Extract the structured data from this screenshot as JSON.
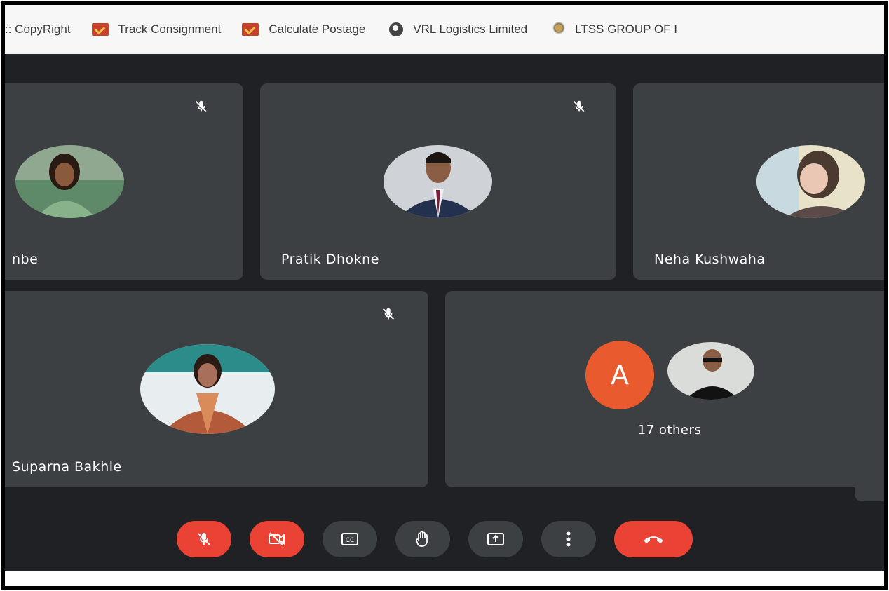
{
  "bookmarks": [
    {
      "label": ":: CopyRight",
      "icon": "none"
    },
    {
      "label": "Track Consignment",
      "icon": "checkmark-icon"
    },
    {
      "label": "Calculate Postage",
      "icon": "checkmark-icon"
    },
    {
      "label": "VRL Logistics Limited",
      "icon": "globe-icon"
    },
    {
      "label": "LTSS GROUP OF I",
      "icon": "emblem-icon"
    }
  ],
  "tiles": [
    {
      "name": "nbe",
      "muted": true
    },
    {
      "name": "Pratik Dhokne",
      "muted": true
    },
    {
      "name": "Neha Kushwaha",
      "muted": false
    },
    {
      "name": "Suparna Bakhle",
      "muted": true
    },
    {
      "others_initial": "A",
      "others_label": "17 others"
    }
  ],
  "controls": [
    {
      "name": "microphone-off",
      "state": "off"
    },
    {
      "name": "camera-off",
      "state": "off"
    },
    {
      "name": "captions",
      "state": "normal"
    },
    {
      "name": "raise-hand",
      "state": "normal"
    },
    {
      "name": "present-screen",
      "state": "normal"
    },
    {
      "name": "more-options",
      "state": "normal"
    },
    {
      "name": "leave-call",
      "state": "end"
    }
  ],
  "colors": {
    "background": "#202124",
    "tile": "#3c4043",
    "red": "#ea4335",
    "avatar_orange": "#ea5a2f"
  }
}
